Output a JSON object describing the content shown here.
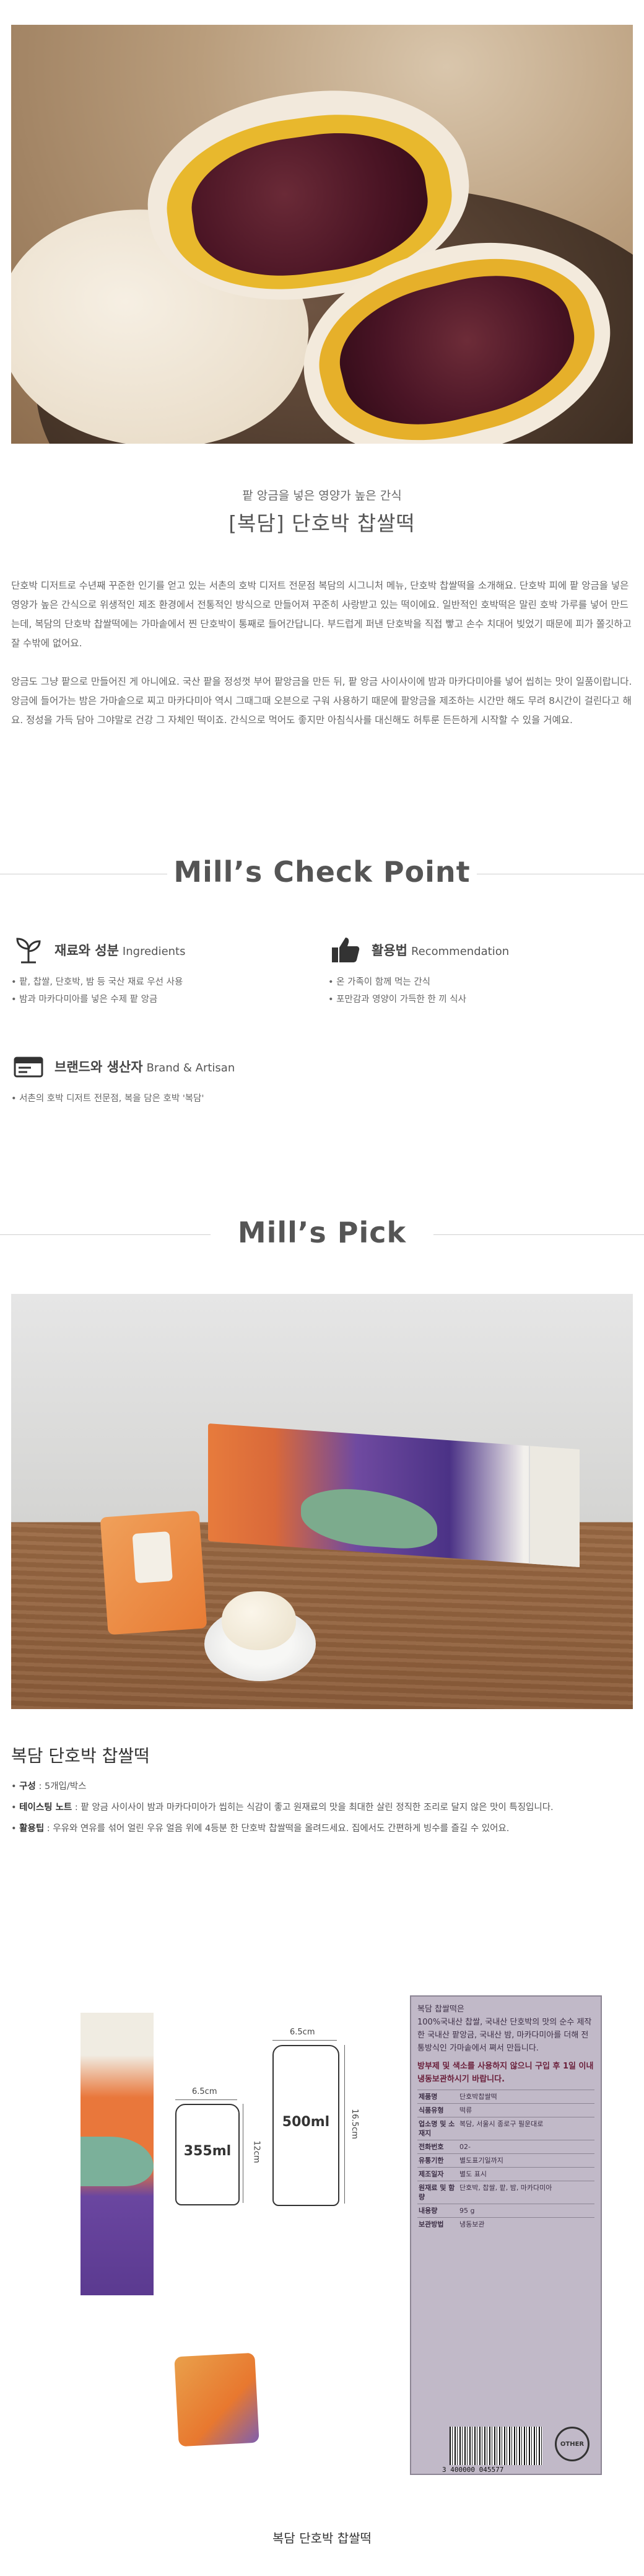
{
  "hero": {
    "alt": ""
  },
  "intro": {
    "subtitle": "팥 앙금을 넣은 영양가 높은 간식",
    "title": "[복담] 단호박 찹쌀떡",
    "paragraph1": "단호박 디저트로 수년째 꾸준한 인기를 얻고 있는 서촌의 호박 디저트 전문점 복담의 시그니처 메뉴, 단호박 찹쌀떡을 소개해요. 단호박 피에 팥 앙금을 넣은 영양가 높은 간식으로 위생적인 제조 환경에서 전통적인 방식으로 만들어져 꾸준히 사랑받고 있는 떡이에요. 일반적인 호박떡은 말린 호박 가루를 넣어 만드는데, 복담의 단호박 찹쌀떡에는 가마솥에서 찐 단호박이 통째로 들어간답니다. 부드럽게 퍼낸 단호박을 직접 빻고 손수 치대어 빚었기 때문에 피가 쫄깃하고 잘 수밖에 없어요.",
    "paragraph2": "앙금도 그냥 팥으로 만들어진 게 아니에요. 국산 팥을 정성껏 부어 팥앙금을 만든 뒤, 팥 앙금 사이사이에 밤과 마카다미아를 넣어 씹히는 맛이 일품이랍니다. 앙금에 들어가는 밤은 가마솥으로 찌고 마카다미아 역시 그때그때 오븐으로 구워 사용하기 때문에 팥앙금을 제조하는 시간만 해도 무려 8시간이 걸린다고 해요. 정성을 가득 담아 그야말로 건강 그 자체인 떡이죠. 간식으로 먹어도 좋지만 아침식사를 대신해도 허투룬 든든하게 시작할 수 있을 거예요."
  },
  "check_point": {
    "heading": "Mill’s Check Point",
    "items": [
      {
        "icon": "sprout-icon",
        "title": "재료와 성분",
        "title_en": "Ingredients",
        "lines": [
          "• 팥, 찹쌀, 단호박, 밤 등 국산 재료 우선 사용",
          "• 밤과 마카다미아를 넣은 수제 팥 앙금"
        ]
      },
      {
        "icon": "thumbs-up-icon",
        "title": "활용법",
        "title_en": "Recommendation",
        "lines": [
          "• 온 가족이 함께 먹는 간식",
          "• 포만감과 영양이 가득한 한 끼 식사"
        ]
      },
      {
        "icon": "brand-card-icon",
        "title": "브랜드와 생산자",
        "title_en": "Brand & Artisan",
        "lines": [
          "• 서촌의 호박 디저트 전문점, 복을 담은 호박 '복담'"
        ]
      }
    ]
  },
  "pick": {
    "heading": "Mill’s Pick",
    "product_name": "복담 단호박 찹쌀떡",
    "details": [
      {
        "key": "구성",
        "value": " : 5개입/박스"
      },
      {
        "key": "테이스팅 노트",
        "value": " : 팥 앙금 사이사이 밤과 마카다미아가 씹히는 식감이 좋고 원재료의 맛을 최대한 살린 정직한 조리로 달지 않은 맛이 특징입니다."
      },
      {
        "key": "활용팁",
        "value": " : 우유와 연유를 섞어 얼린 우유 얼음 위에 4등분 한 단호박 찹쌀떡을 올려드세요. 집에서도 간편하게 빙수를 즐길 수 있어요."
      }
    ]
  },
  "package": {
    "can1_label": "355ml",
    "can2_label": "500ml",
    "dim_can1_width": "6.5cm",
    "dim_can1_height": "12cm",
    "dim_can2_width": "6.5cm",
    "dim_can2_height": "16.5cm",
    "label_intro": "복담 찹쌀떡은",
    "label_body": "100%국내산 찹쌀, 국내산 단호박의 맛의 순수 제작한 국내산 팥앙금, 국내산 밤, 마카다미아를 더해 전통방식인 가마솥에서 쪄서 만듭니다.",
    "label_warning": "방부제 및 색소를 사용하지 않으니 구입 후 1일 이내 냉동보관하시기 바랍니다.",
    "label_rows": [
      {
        "k": "제품명",
        "v": "단호박찹쌀떡"
      },
      {
        "k": "식품유형",
        "v": "떡류"
      },
      {
        "k": "업소명 및 소재지",
        "v": "복담, 서울시 종로구 필운대로"
      },
      {
        "k": "전화번호",
        "v": "02-"
      },
      {
        "k": "유통기한",
        "v": "별도표기일까지"
      },
      {
        "k": "제조일자",
        "v": "별도 표시"
      },
      {
        "k": "원재료 및 함량",
        "v": "단호박, 찹쌀, 팥, 밤, 마카다미아"
      },
      {
        "k": "내용량",
        "v": "95 g"
      },
      {
        "k": "보관방법",
        "v": "냉동보관"
      }
    ],
    "barcode_number": "3 400000 045577",
    "recycle_text": "OTHER",
    "caption": "복담 단호박 찹쌀떡"
  }
}
